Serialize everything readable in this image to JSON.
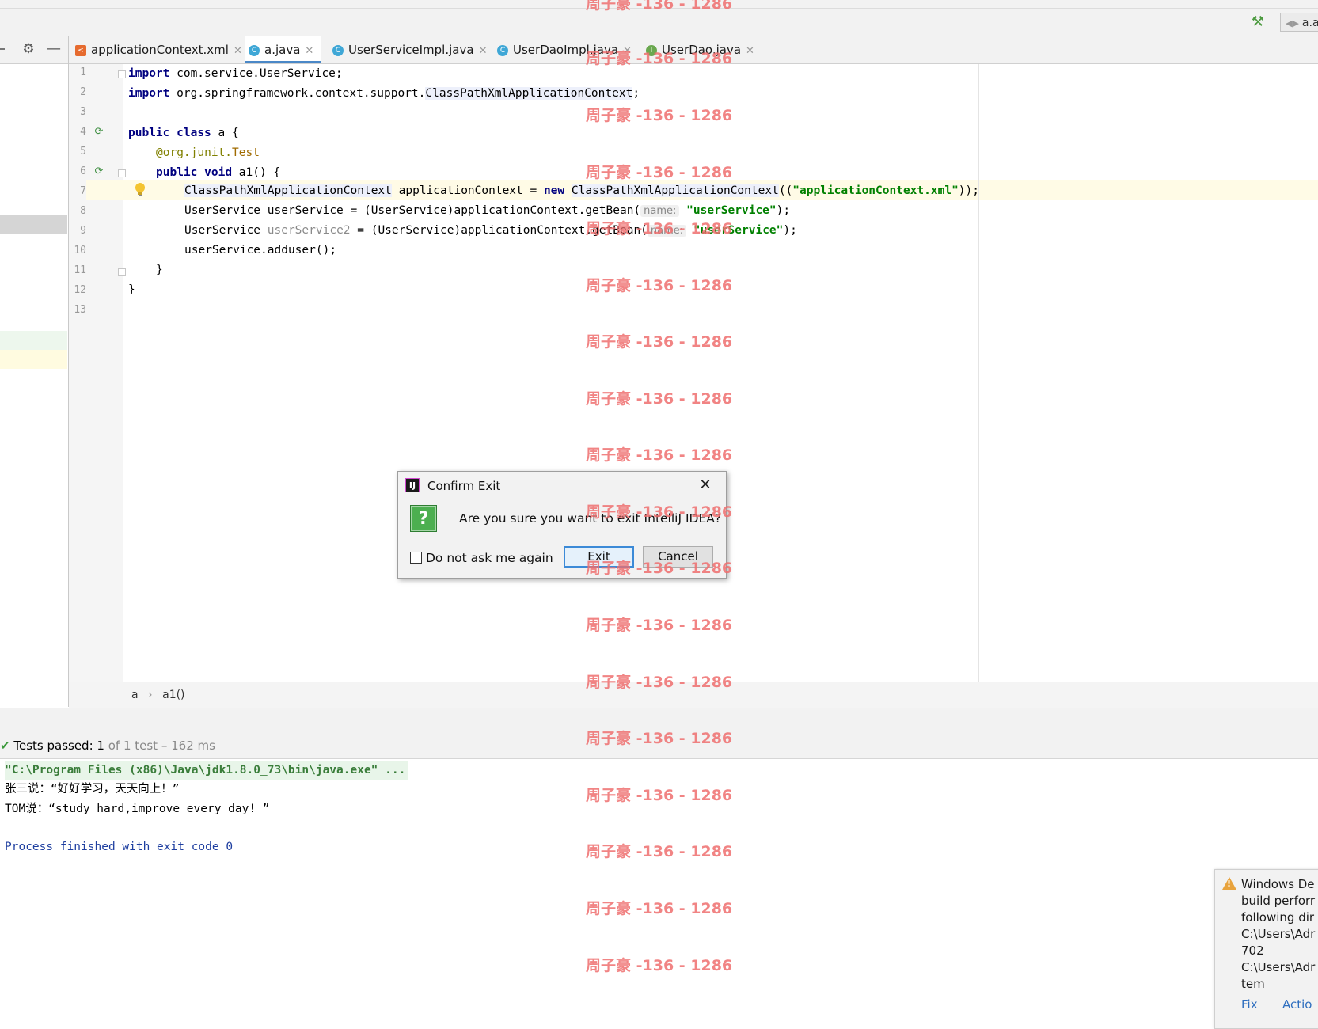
{
  "toolbar": {
    "run_config_label": "a.a",
    "build_icon": "hammer-icon"
  },
  "project_panel": {
    "settings_icon": "gear-icon",
    "hide_icon": "minus-icon"
  },
  "tabs": [
    {
      "label": "applicationContext.xml",
      "icon": "xml-file-icon",
      "icon_color": "#e66b2f"
    },
    {
      "label": "a.java",
      "icon": "java-class-icon",
      "icon_color": "#3fa7d6"
    },
    {
      "label": "UserServiceImpl.java",
      "icon": "java-class-icon",
      "icon_color": "#3fa7d6"
    },
    {
      "label": "UserDaoImpl.java",
      "icon": "java-class-icon",
      "icon_color": "#3fa7d6"
    },
    {
      "label": "UserDao.java",
      "icon": "java-interface-icon",
      "icon_color": "#6aa84f"
    }
  ],
  "editor": {
    "line_numbers": [
      "1",
      "2",
      "3",
      "4",
      "5",
      "6",
      "7",
      "8",
      "9",
      "10",
      "11",
      "12",
      "13"
    ],
    "code": {
      "l1_kw": "import",
      "l1_rest": " com.service.UserService;",
      "l2_kw": "import",
      "l2_rest": " org.springframework.context.support.",
      "l2_hl": "ClassPathXmlApplicationContext",
      "l2_end": ";",
      "l4_kw1": "public",
      "l4_kw2": "class",
      "l4_rest": " a {",
      "l5_ann_prefix": "@org.junit.",
      "l5_ann_name": "Test",
      "l6_kw1": "public",
      "l6_kw2": "void",
      "l6_rest": " a1() {",
      "l7_type": "ClassPathXmlApplicationContext",
      "l7_mid": " applicationContext = ",
      "l7_kw": "new",
      "l7_sp": " ",
      "l7_ctor": "ClassPathXmlApplicationContext",
      "l7_open": "((",
      "l7_str": "\"applicationContext.xml\"",
      "l7_end": "));",
      "l8_pre": "UserService userService = (UserService)applicationContext.getBean(",
      "l8_hint": "name:",
      "l8_str": "\"userService\"",
      "l8_end": ");",
      "l9_type": "UserService ",
      "l9_var": "userService2",
      "l9_pre": " = (UserService)applicationContext.getBean(",
      "l9_hint": "name:",
      "l9_str": "\"userService\"",
      "l9_end": ");",
      "l10": "userService.adduser();",
      "l11": "}",
      "l12": "}"
    }
  },
  "breadcrumb": {
    "class": "a",
    "sep": "›",
    "method": "a1()"
  },
  "run_panel": {
    "status_prefix": "Tests passed: ",
    "status_count": "1",
    "status_rest": " of 1 test – 162 ms",
    "console_lines": [
      "\"C:\\Program Files (x86)\\Java\\jdk1.8.0_73\\bin\\java.exe\" ...",
      "张三说：“好好学习，天天向上！”",
      "TOM说：“study hard,improve every day! ”",
      "Process finished with exit code 0"
    ]
  },
  "notification": {
    "lines": [
      "Windows De",
      "build perforr",
      "following dir",
      "C:\\Users\\Adr",
      "702",
      "C:\\Users\\Adr",
      "tem"
    ],
    "link_fix": "Fix",
    "link_actions": "Actio"
  },
  "dialog": {
    "title": "Confirm Exit",
    "message": "Are you sure you want to exit IntelliJ IDEA?",
    "checkbox_label": "Do not ask me again",
    "checkbox_checked": false,
    "exit_label": "Exit",
    "cancel_label": "Cancel"
  },
  "watermark": {
    "text": "周子豪 -136 - 1286",
    "color": "#ef6f6f"
  },
  "colors": {
    "keyword": "#000080",
    "string": "#008000",
    "annotation": "#808000",
    "caret_row": "#fffbe6",
    "console_path": "#e8f5e9",
    "process_text": "#1f3fa0"
  }
}
